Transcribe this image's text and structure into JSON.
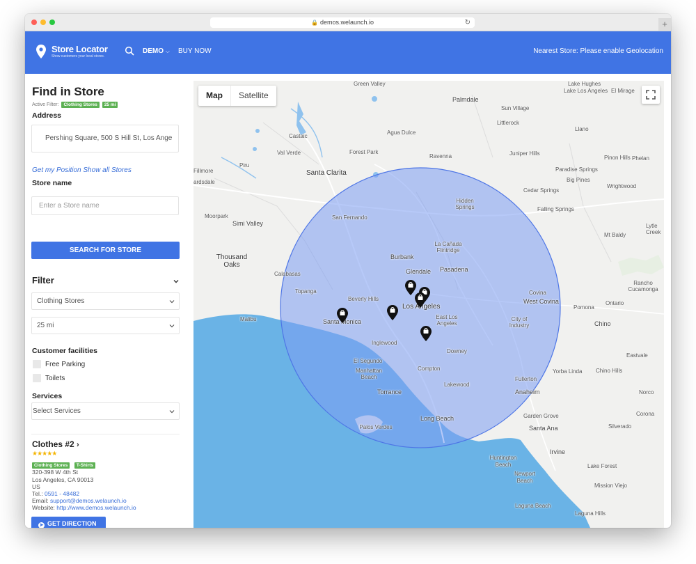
{
  "browser": {
    "url": "demos.welaunch.io"
  },
  "header": {
    "logo_title": "Store Locator",
    "logo_subtitle": "Show customers your local stores.",
    "nav": {
      "demo": "DEMO",
      "buy_now": "BUY NOW"
    },
    "nearest_store": "Nearest Store: Please enable Geolocation"
  },
  "sidebar": {
    "title": "Find in Store",
    "active_filter_label": "Active Filter:",
    "active_filters": [
      "Clothing Stores",
      "25 mi"
    ],
    "address_label": "Address",
    "address_value": "Pershing Square, 500 S Hill St, Los Ange",
    "links": {
      "get_position": "Get my Position",
      "show_all": "Show all Stores"
    },
    "store_name_label": "Store name",
    "store_name_placeholder": "Enter a Store name",
    "search_button": "SEARCH FOR STORE",
    "filter": {
      "title": "Filter",
      "category_selected": "Clothing Stores",
      "radius_selected": "25 mi",
      "facilities_label": "Customer facilities",
      "facilities": [
        "Free Parking",
        "Toilets"
      ],
      "services_label": "Services",
      "services_placeholder": "Select Services"
    },
    "result": {
      "name": "Clothes #2",
      "rating": 5,
      "stars": "★★★★★",
      "tags": [
        "Clothing Stores",
        "T-Shirts"
      ],
      "address_line1": "320-398 W 4th St",
      "address_line2": "Los Angeles, CA 90013",
      "country": "US",
      "tel_label": "Tel.:",
      "tel": "0591 - 48482",
      "email_label": "Email:",
      "email": "support@demos.welaunch.io",
      "website_label": "Website:",
      "website": "http://www.demos.welaunch.io",
      "direction_button": "GET DIRECTION"
    }
  },
  "map": {
    "tabs": {
      "map": "Map",
      "satellite": "Satellite"
    },
    "places": [
      "Green Valley",
      "Lake Hughes",
      "Lake Los Angeles",
      "El Mirage",
      "Palmdale",
      "Sun Village",
      "Littlerock",
      "Castaic",
      "Agua Dulce",
      "Llano",
      "Val Verde",
      "Forest Park",
      "Ravenna",
      "Juniper Hills",
      "Piru",
      "Fillmore",
      "Santa Clarita",
      "Pinon Hills",
      "Phelan",
      "Paradise Springs",
      "Big Pines",
      "Wrightwood",
      "ardsdale",
      "Cedar Springs",
      "Hidden Springs",
      "Falling Springs",
      "Moorpark",
      "Simi Valley",
      "San Fernando",
      "Mt Baldy",
      "Lytle Creek",
      "Thousand Oaks",
      "Burbank",
      "La Cañada Flintridge",
      "Glendale",
      "Pasadena",
      "Calabasas",
      "Topanga",
      "Beverly Hills",
      "Los Angeles",
      "Covina",
      "West Covina",
      "Rancho Cucamonga",
      "Ontario",
      "Pomona",
      "Malibu",
      "Santa Monica",
      "East Los Angeles",
      "City of Industry",
      "Chino",
      "Inglewood",
      "El Segundo",
      "Downey",
      "Eastvale",
      "Manhattan Beach",
      "Compton",
      "Chino Hills",
      "Norco",
      "Torrance",
      "Lakewood",
      "Yorba Linda",
      "Fullerton",
      "Anaheim",
      "Palos Verdes",
      "Long Beach",
      "Garden Grove",
      "Corona",
      "Santa Ana",
      "Silverado",
      "Huntington Beach",
      "Irvine",
      "Lake Forest",
      "Newport Beach",
      "Mission Viejo",
      "Laguna Beach",
      "Laguna Hills"
    ],
    "search_radius": "25 mi",
    "markers": 6
  },
  "colors": {
    "primary": "#4074e4",
    "tag_green": "#5db153",
    "link": "#3a6fd8",
    "water": "#6ab3e6",
    "radius_fill": "#7c9cf2"
  }
}
